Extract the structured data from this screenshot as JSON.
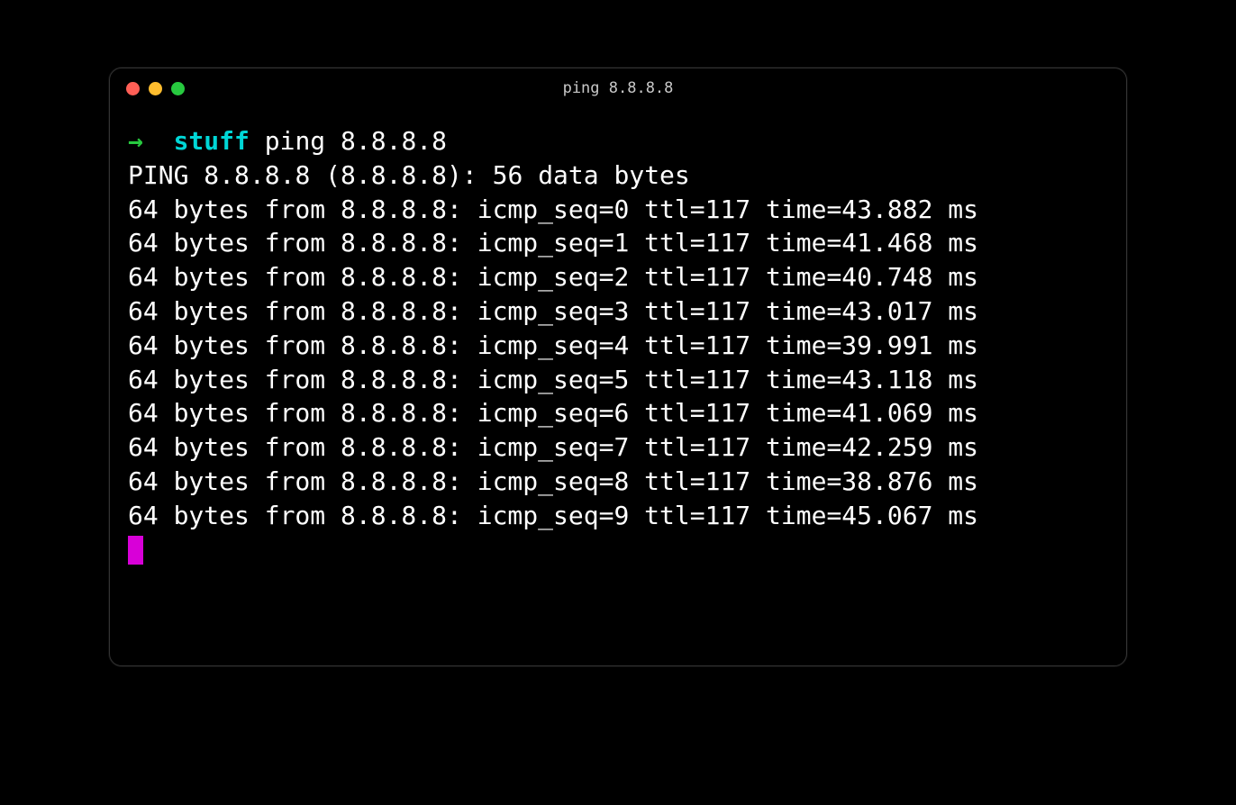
{
  "window": {
    "title": "ping 8.8.8.8"
  },
  "prompt": {
    "arrow": "→",
    "directory": "stuff",
    "command": "ping 8.8.8.8"
  },
  "ping": {
    "header_prefix": "PING ",
    "target": "8.8.8.8",
    "target_ip": "8.8.8.8",
    "data_bytes": 56,
    "header_suffix": " data bytes",
    "replies": [
      {
        "bytes": 64,
        "from": "8.8.8.8",
        "icmp_seq": 0,
        "ttl": 117,
        "time": "43.882"
      },
      {
        "bytes": 64,
        "from": "8.8.8.8",
        "icmp_seq": 1,
        "ttl": 117,
        "time": "41.468"
      },
      {
        "bytes": 64,
        "from": "8.8.8.8",
        "icmp_seq": 2,
        "ttl": 117,
        "time": "40.748"
      },
      {
        "bytes": 64,
        "from": "8.8.8.8",
        "icmp_seq": 3,
        "ttl": 117,
        "time": "43.017"
      },
      {
        "bytes": 64,
        "from": "8.8.8.8",
        "icmp_seq": 4,
        "ttl": 117,
        "time": "39.991"
      },
      {
        "bytes": 64,
        "from": "8.8.8.8",
        "icmp_seq": 5,
        "ttl": 117,
        "time": "43.118"
      },
      {
        "bytes": 64,
        "from": "8.8.8.8",
        "icmp_seq": 6,
        "ttl": 117,
        "time": "41.069"
      },
      {
        "bytes": 64,
        "from": "8.8.8.8",
        "icmp_seq": 7,
        "ttl": 117,
        "time": "42.259"
      },
      {
        "bytes": 64,
        "from": "8.8.8.8",
        "icmp_seq": 8,
        "ttl": 117,
        "time": "38.876"
      },
      {
        "bytes": 64,
        "from": "8.8.8.8",
        "icmp_seq": 9,
        "ttl": 117,
        "time": "45.067"
      }
    ]
  },
  "colors": {
    "cursor": "#d800d8",
    "prompt_arrow": "#27c93f",
    "prompt_dir": "#00d7d7"
  }
}
